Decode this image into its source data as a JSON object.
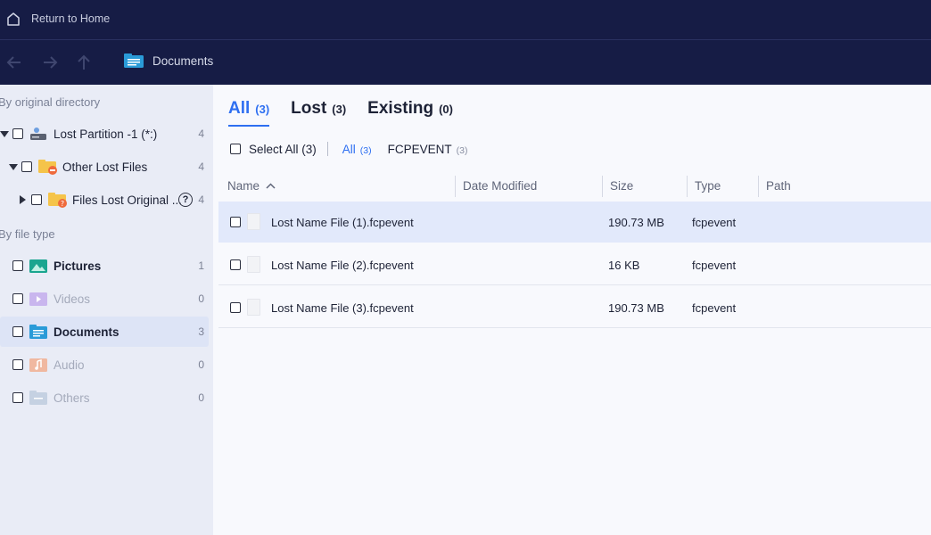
{
  "header": {
    "home_label": "Return to Home"
  },
  "nav": {
    "breadcrumb": "Documents"
  },
  "sidebar": {
    "by_directory_label": "By original directory",
    "tree": [
      {
        "label": "Lost Partition -1 (*:)",
        "count": "4"
      },
      {
        "label": "Other Lost Files",
        "count": "4"
      },
      {
        "label": "Files Lost Original ...",
        "count": "4",
        "help": "?"
      }
    ],
    "by_type_label": "By file type",
    "types": [
      {
        "label": "Pictures",
        "count": "1"
      },
      {
        "label": "Videos",
        "count": "0"
      },
      {
        "label": "Documents",
        "count": "3"
      },
      {
        "label": "Audio",
        "count": "0"
      },
      {
        "label": "Others",
        "count": "0"
      }
    ]
  },
  "tabs": [
    {
      "label": "All",
      "count": "(3)"
    },
    {
      "label": "Lost",
      "count": "(3)"
    },
    {
      "label": "Existing",
      "count": "(0)"
    }
  ],
  "filters": {
    "select_all": "Select All (3)",
    "chips": [
      {
        "label": "All",
        "count": "(3)"
      },
      {
        "label": "FCPEVENT",
        "count": "(3)"
      }
    ]
  },
  "table": {
    "columns": [
      "Name",
      "Date Modified",
      "Size",
      "Type",
      "Path"
    ],
    "rows": [
      {
        "name": "Lost Name File (1).fcpevent",
        "date": "",
        "size": "190.73 MB",
        "type": "fcpevent",
        "path": ""
      },
      {
        "name": "Lost Name File (2).fcpevent",
        "date": "",
        "size": "16 KB",
        "type": "fcpevent",
        "path": ""
      },
      {
        "name": "Lost Name File (3).fcpevent",
        "date": "",
        "size": "190.73 MB",
        "type": "fcpevent",
        "path": ""
      }
    ]
  },
  "colors": {
    "topbar": "#161c45",
    "accent": "#2e6ff1",
    "sidebar": "#e9ecf6",
    "selected_row": "#e2e9fb"
  }
}
